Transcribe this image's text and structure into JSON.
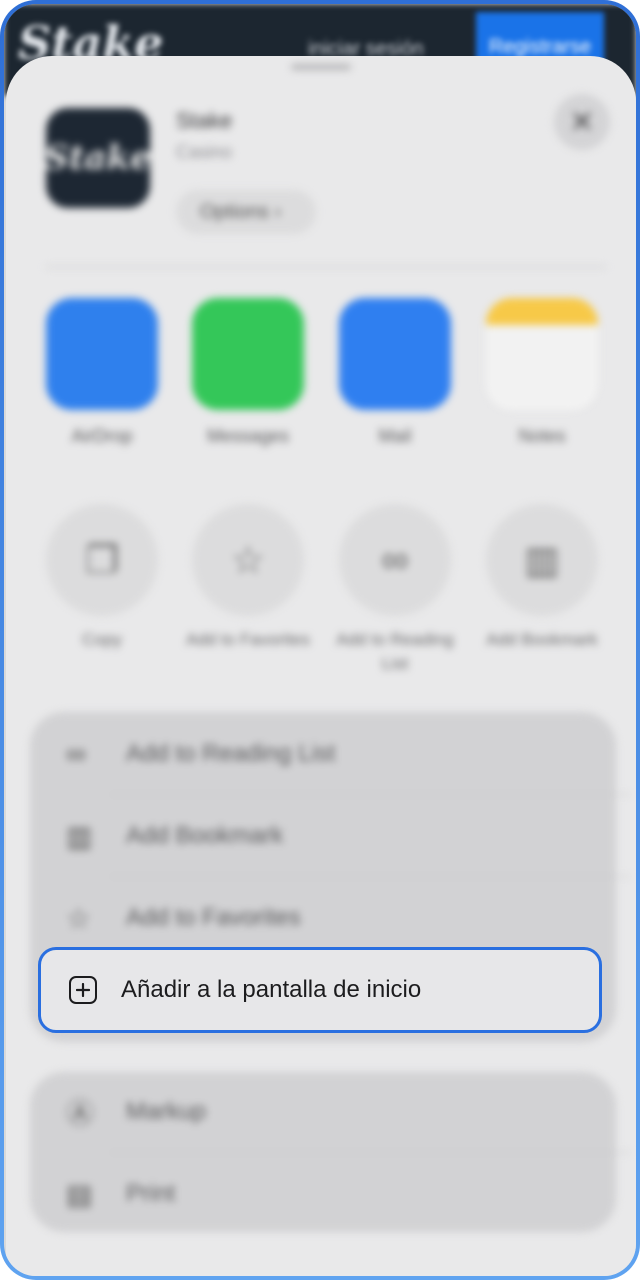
{
  "site": {
    "logo_text": "Stake",
    "link_text": "iniciar sesión",
    "button_text": "Registrarse"
  },
  "share_sheet": {
    "app": {
      "name": "Stake",
      "subtitle": "Casino",
      "options_label": "Options"
    },
    "close_icon": "close-icon",
    "apps": [
      {
        "label": "AirDrop",
        "color": "#2f80ed"
      },
      {
        "label": "Messages",
        "color": "#34c759"
      },
      {
        "label": "Mail",
        "color": "#2f7ff0"
      },
      {
        "label": "Notes",
        "color": "#f7c948"
      }
    ],
    "actions": [
      {
        "label": "Copy",
        "icon": "copy-icon"
      },
      {
        "label": "Add to Favorites",
        "icon": "star-icon"
      },
      {
        "label": "Add to Reading List",
        "icon": "glasses-icon"
      },
      {
        "label": "Add Bookmark",
        "icon": "book-icon"
      }
    ],
    "list_group_1": [
      {
        "label": "Add to Reading List",
        "icon": "glasses-icon"
      },
      {
        "label": "Add Bookmark",
        "icon": "book-icon"
      },
      {
        "label": "Add to Favorites",
        "icon": "star-icon"
      }
    ],
    "highlighted_action": {
      "label": "Añadir a la pantalla de inicio",
      "icon": "add-square-icon",
      "border_color": "#2a6fe0"
    },
    "list_group_2": [
      {
        "label": "Markup",
        "icon": "markup-icon"
      },
      {
        "label": "Print",
        "icon": "print-icon"
      }
    ]
  }
}
